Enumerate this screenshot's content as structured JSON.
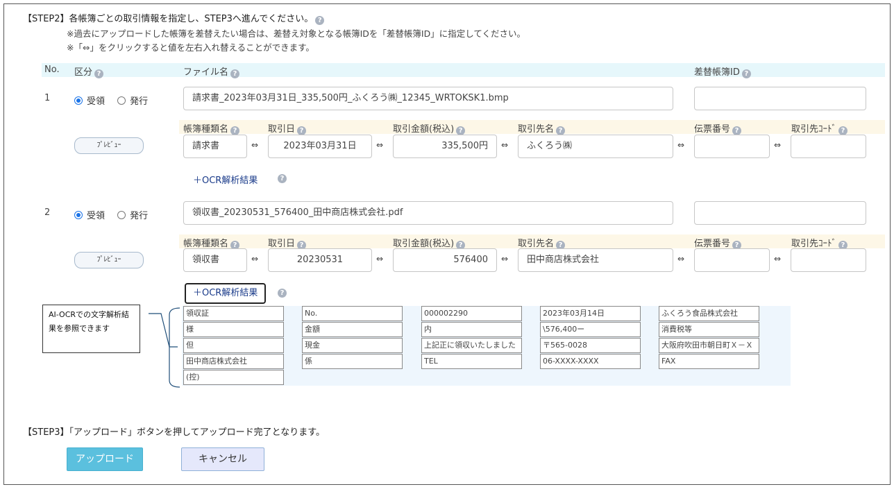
{
  "step2": {
    "title": "【STEP2】各帳簿ごとの取引情報を指定し、STEP3へ進んでください。",
    "note1": "※過去にアップロードした帳簿を差替えたい場合は、差替え対象となる帳簿IDを「差替帳簿ID」に指定してください。",
    "note2": "※「⇔」をクリックすると値を左右入れ替えることができます。"
  },
  "headers": {
    "no": "No.",
    "kubun": "区分",
    "filename": "ファイル名",
    "replace_id": "差替帳簿ID"
  },
  "sub_headers": {
    "doc_type": "帳簿種類名",
    "date": "取引日",
    "amount": "取引金額(税込)",
    "partner": "取引先名",
    "slip_no": "伝票番号",
    "partner_code": "取引先ｺｰﾄﾞ"
  },
  "common": {
    "receive": "受領",
    "issue": "発行",
    "preview": "ﾌﾟﾚﾋﾞｭｰ",
    "ocr": "＋OCR解析結果",
    "swap": "⇔",
    "help": "?"
  },
  "rows": [
    {
      "no": "1",
      "filename": "請求書_2023年03月31日_335,500円_ふくろう㈱_12345_WRTOKSK1.bmp",
      "replace_id": "",
      "doc_type": "請求書",
      "date": "2023年03月31日",
      "amount": "335,500円",
      "partner": "ふくろう㈱",
      "slip_no": "",
      "partner_code": ""
    },
    {
      "no": "2",
      "filename": "領収書_20230531_576400_田中商店株式会社.pdf",
      "replace_id": "",
      "doc_type": "領収書",
      "date": "20230531",
      "amount": "576400",
      "partner": "田中商店株式会社",
      "slip_no": "",
      "partner_code": ""
    }
  ],
  "ocr_cells": [
    [
      "領収証",
      "No.",
      "000002290",
      "2023年03月14日",
      "ふくろう食品株式会社"
    ],
    [
      "様",
      "金額",
      "内",
      "\\576,400ー",
      "消費税等"
    ],
    [
      "但",
      "現金",
      "上記正に領収いたしました",
      "〒565-0028",
      "大阪府吹田市朝日町Ｘ－Ｘ"
    ],
    [
      "田中商店株式会社",
      "係",
      "TEL",
      "06-XXXX-XXXX",
      "FAX"
    ],
    [
      "(控)"
    ]
  ],
  "callout": "AI-OCRでの文字解析結果を参照できます",
  "step3": {
    "title": "【STEP3】「アップロード」ボタンを押してアップロード完了となります。"
  },
  "buttons": {
    "upload": "アップロード",
    "cancel": "キャンセル"
  }
}
